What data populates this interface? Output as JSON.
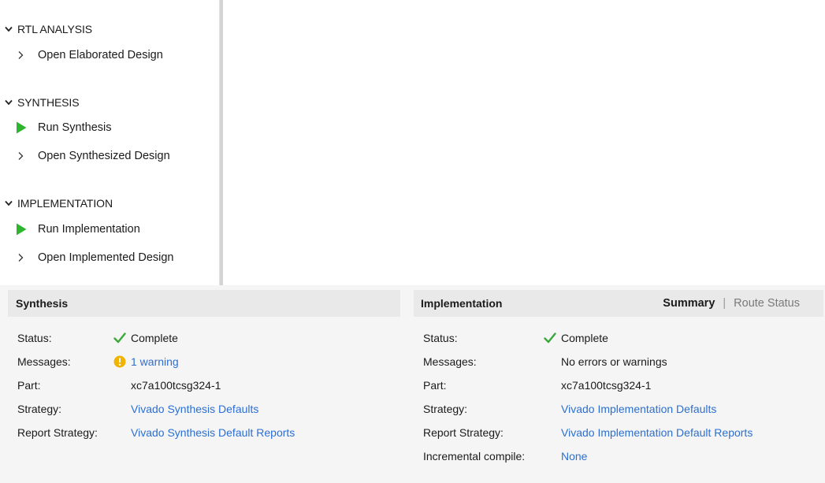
{
  "flow_navigator": {
    "sections": [
      {
        "label": "RTL ANALYSIS",
        "items": [
          {
            "label": "Open Elaborated Design",
            "icon": "chevron-right-icon"
          }
        ]
      },
      {
        "label": "SYNTHESIS",
        "items": [
          {
            "label": "Run Synthesis",
            "icon": "run-play-icon"
          },
          {
            "label": "Open Synthesized Design",
            "icon": "chevron-right-icon"
          }
        ]
      },
      {
        "label": "IMPLEMENTATION",
        "items": [
          {
            "label": "Run Implementation",
            "icon": "run-play-icon"
          },
          {
            "label": "Open Implemented Design",
            "icon": "chevron-right-icon"
          }
        ]
      }
    ]
  },
  "synthesis": {
    "title": "Synthesis",
    "rows": {
      "status": {
        "label": "Status:",
        "value": "Complete",
        "icon": "check-icon"
      },
      "messages": {
        "label": "Messages:",
        "value": "1 warning",
        "icon": "warning-icon"
      },
      "part": {
        "label": "Part:",
        "value": "xc7a100tcsg324-1"
      },
      "strategy": {
        "label": "Strategy:",
        "value": "Vivado Synthesis Defaults"
      },
      "report_strategy": {
        "label": "Report Strategy:",
        "value": "Vivado Synthesis Default Reports"
      }
    }
  },
  "implementation": {
    "title": "Implementation",
    "tabs": {
      "summary": "Summary",
      "separator": "|",
      "route_status": "Route Status",
      "active": "Summary"
    },
    "rows": {
      "status": {
        "label": "Status:",
        "value": "Complete",
        "icon": "check-icon"
      },
      "messages": {
        "label": "Messages:",
        "value": "No errors or warnings"
      },
      "part": {
        "label": "Part:",
        "value": "xc7a100tcsg324-1"
      },
      "strategy": {
        "label": "Strategy:",
        "value": "Vivado Implementation Defaults"
      },
      "report_strategy": {
        "label": "Report Strategy:",
        "value": "Vivado Implementation Default Reports"
      },
      "incremental_compile": {
        "label": "Incremental compile:",
        "value": "None"
      }
    }
  },
  "colors": {
    "link": "#2c6fd1",
    "success_green": "#3aa83a",
    "warning_amber": "#f0b400",
    "run_green": "#2db52d",
    "panel_header": "#e9e9e9",
    "panel_background": "#f5f5f5"
  }
}
